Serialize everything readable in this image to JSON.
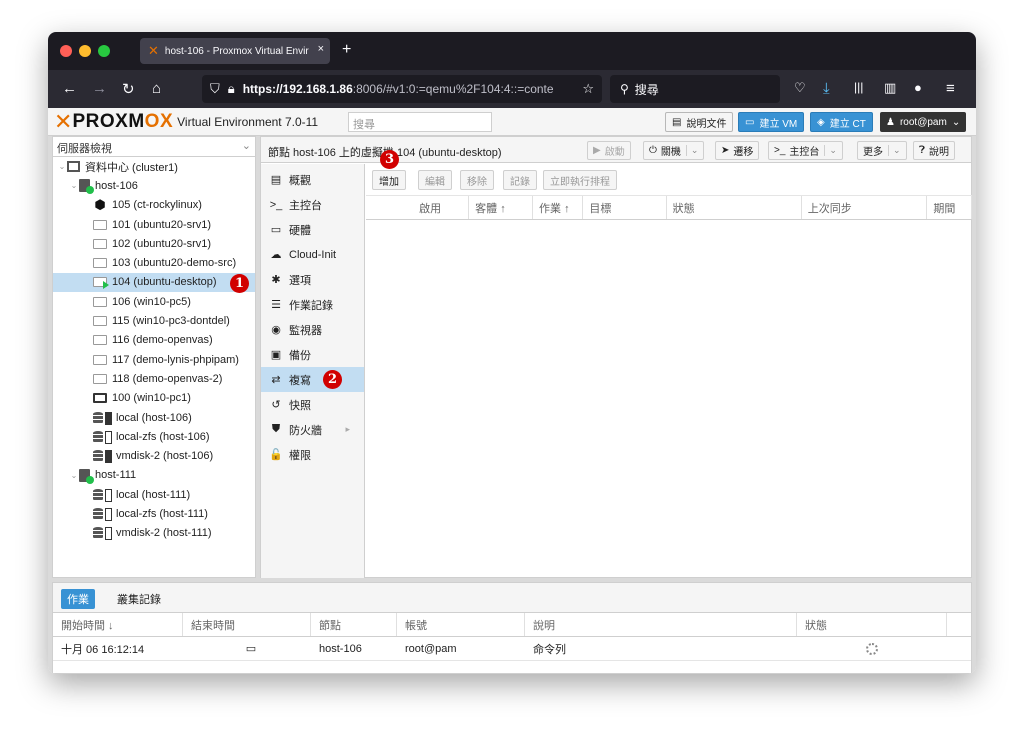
{
  "browser": {
    "tab_title": "host-106 - Proxmox Virtual Envir",
    "tab_close": "×",
    "new_tab": "+",
    "url_host": "https://192.168.1.86",
    "url_rest": ":8006/#v1:0:=qemu%2F104:4::=conte",
    "search_placeholder": "搜尋"
  },
  "header": {
    "logo_text": "PROXMOX",
    "version": "Virtual Environment 7.0-11",
    "search_placeholder": "搜尋",
    "docs_button": "說明文件",
    "create_vm_button": "建立 VM",
    "create_ct_button": "建立 CT",
    "user_button": "root@pam"
  },
  "tree": {
    "view_select": "伺服器檢視",
    "datacenter": "資料中心 (cluster1)",
    "node1": "host-106",
    "items1": [
      {
        "label": "105 (ct-rockylinux)",
        "kind": "ct"
      },
      {
        "label": "101 (ubuntu20-srv1)",
        "kind": "vm"
      },
      {
        "label": "102 (ubuntu20-srv1)",
        "kind": "vm"
      },
      {
        "label": "103 (ubuntu20-demo-src)",
        "kind": "vm"
      },
      {
        "label": "104 (ubuntu-desktop)",
        "kind": "vm-run"
      },
      {
        "label": "106 (win10-pc5)",
        "kind": "vm"
      },
      {
        "label": "115 (win10-pc3-dontdel)",
        "kind": "vm"
      },
      {
        "label": "116 (demo-openvas)",
        "kind": "vm"
      },
      {
        "label": "117 (demo-lynis-phpipam)",
        "kind": "vm"
      },
      {
        "label": "118 (demo-openvas-2)",
        "kind": "vm"
      },
      {
        "label": "100 (win10-pc1)",
        "kind": "vm-dark"
      },
      {
        "label": "local (host-106)",
        "kind": "stor-full"
      },
      {
        "label": "local-zfs (host-106)",
        "kind": "stor"
      },
      {
        "label": "vmdisk-2 (host-106)",
        "kind": "stor-full"
      }
    ],
    "node2": "host-111",
    "items2": [
      {
        "label": "local (host-111)",
        "kind": "stor"
      },
      {
        "label": "local-zfs (host-111)",
        "kind": "stor"
      },
      {
        "label": "vmdisk-2 (host-111)",
        "kind": "stor"
      }
    ]
  },
  "content": {
    "title": "節點 host-106 上的虛擬機 104 (ubuntu-desktop)",
    "toolbar": {
      "start": "啟動",
      "shutdown": "關機",
      "migrate": "遷移",
      "console": "主控台",
      "more": "更多",
      "help": "說明"
    },
    "menu": [
      {
        "label": "概觀",
        "icon": "book-icon",
        "glyph": "▤"
      },
      {
        "label": "主控台",
        "icon": "terminal-icon",
        "glyph": ">_"
      },
      {
        "label": "硬體",
        "icon": "desktop-icon",
        "glyph": "▭"
      },
      {
        "label": "Cloud-Init",
        "icon": "cloud-icon",
        "glyph": "☁"
      },
      {
        "label": "選項",
        "icon": "gear-icon",
        "glyph": "✱"
      },
      {
        "label": "作業記錄",
        "icon": "list-icon",
        "glyph": "☰"
      },
      {
        "label": "監視器",
        "icon": "eye-icon",
        "glyph": "◉"
      },
      {
        "label": "備份",
        "icon": "floppy-icon",
        "glyph": "▣"
      },
      {
        "label": "複寫",
        "icon": "retweet-icon",
        "glyph": "⇄"
      },
      {
        "label": "快照",
        "icon": "history-icon",
        "glyph": "↺"
      },
      {
        "label": "防火牆",
        "icon": "shield-icon",
        "glyph": "⛊"
      },
      {
        "label": "權限",
        "icon": "unlock-icon",
        "glyph": "🔓"
      }
    ],
    "grid_buttons": {
      "add": "增加",
      "edit": "編輯",
      "remove": "移除",
      "log": "記錄",
      "schedule_now": "立即執行排程"
    },
    "grid_columns": [
      "啟用",
      "客體 ↑",
      "作業 ↑",
      "目標",
      "狀態",
      "上次同步",
      "期間"
    ]
  },
  "log": {
    "tab_tasks": "作業",
    "tab_cluster": "叢集記錄",
    "columns": [
      "開始時間 ↓",
      "結束時間",
      "節點",
      "帳號",
      "說明",
      "狀態"
    ],
    "row": {
      "start": "十月 06 16:12:14",
      "node": "host-106",
      "user": "root@pam",
      "desc": "命令列"
    }
  },
  "annotations": [
    "1",
    "2",
    "3"
  ],
  "colors": {
    "accent": "#3892d4",
    "brand": "#e57000",
    "selected": "#c2ddf2",
    "badge": "#d10000",
    "running": "#21bf4b"
  }
}
